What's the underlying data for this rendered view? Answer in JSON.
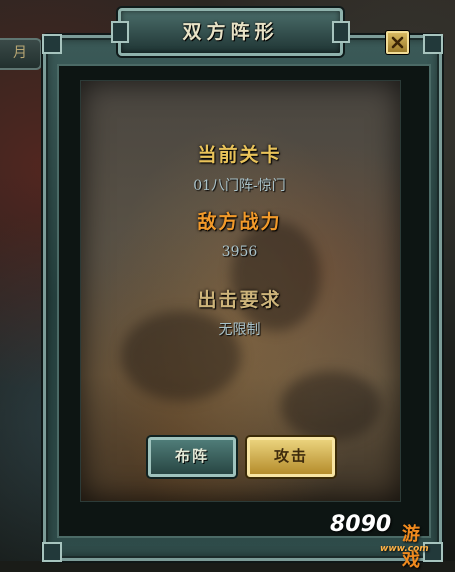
{
  "background": {
    "tab_label": "月"
  },
  "dialog": {
    "title": "双方阵形",
    "current_level_label": "当前关卡",
    "current_level_value": "01八门阵-惊门",
    "enemy_power_label": "敌方战力",
    "enemy_power_value": "3956",
    "requirement_label": "出击要求",
    "requirement_value": "无限制",
    "deploy_button": "布阵",
    "attack_button": "攻击"
  },
  "watermark": {
    "number": "8090",
    "site": "www.com",
    "label": "游戏"
  },
  "colors": {
    "gold_label": "#e9c35a",
    "orange_label": "#f29a2a",
    "tan_label": "#cdb47a",
    "value_text": "#a9c2c9",
    "frame": "#7c9c98"
  }
}
